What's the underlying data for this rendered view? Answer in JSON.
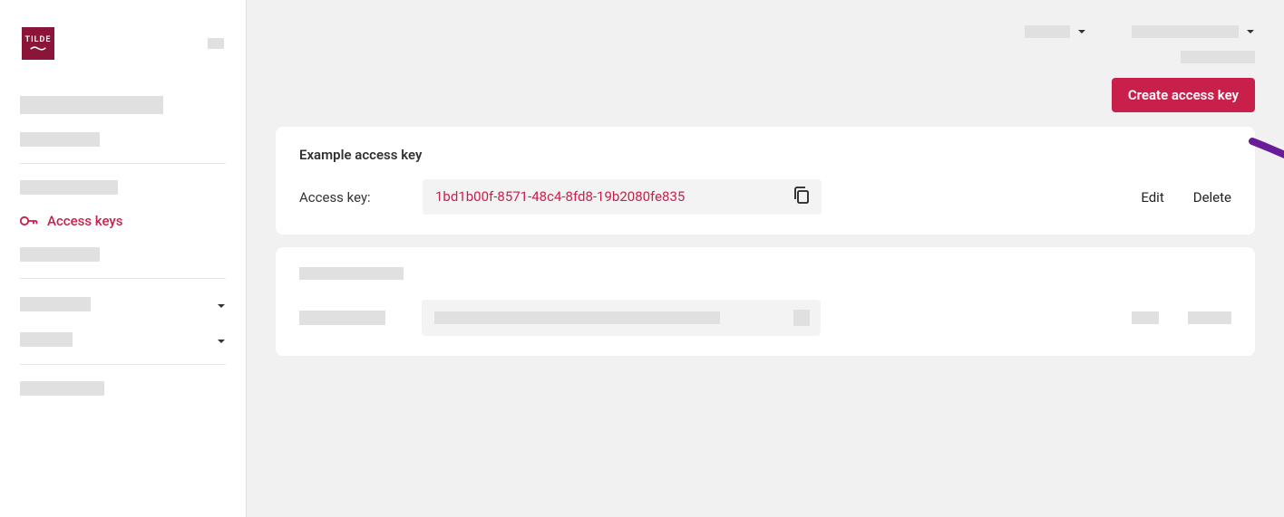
{
  "brand": {
    "name": "TILDE"
  },
  "sidebar": {
    "active_item": {
      "label": "Access keys"
    }
  },
  "actions": {
    "create_button": "Create access key"
  },
  "access_key_card": {
    "title": "Example access key",
    "label": "Access key:",
    "value": "1bd1b00f-8571-48c4-8fd8-19b2080fe835",
    "edit": "Edit",
    "delete": "Delete"
  },
  "colors": {
    "brand": "#8a1538",
    "accent": "#c91f4b",
    "annotation": "#6a1b9a"
  }
}
